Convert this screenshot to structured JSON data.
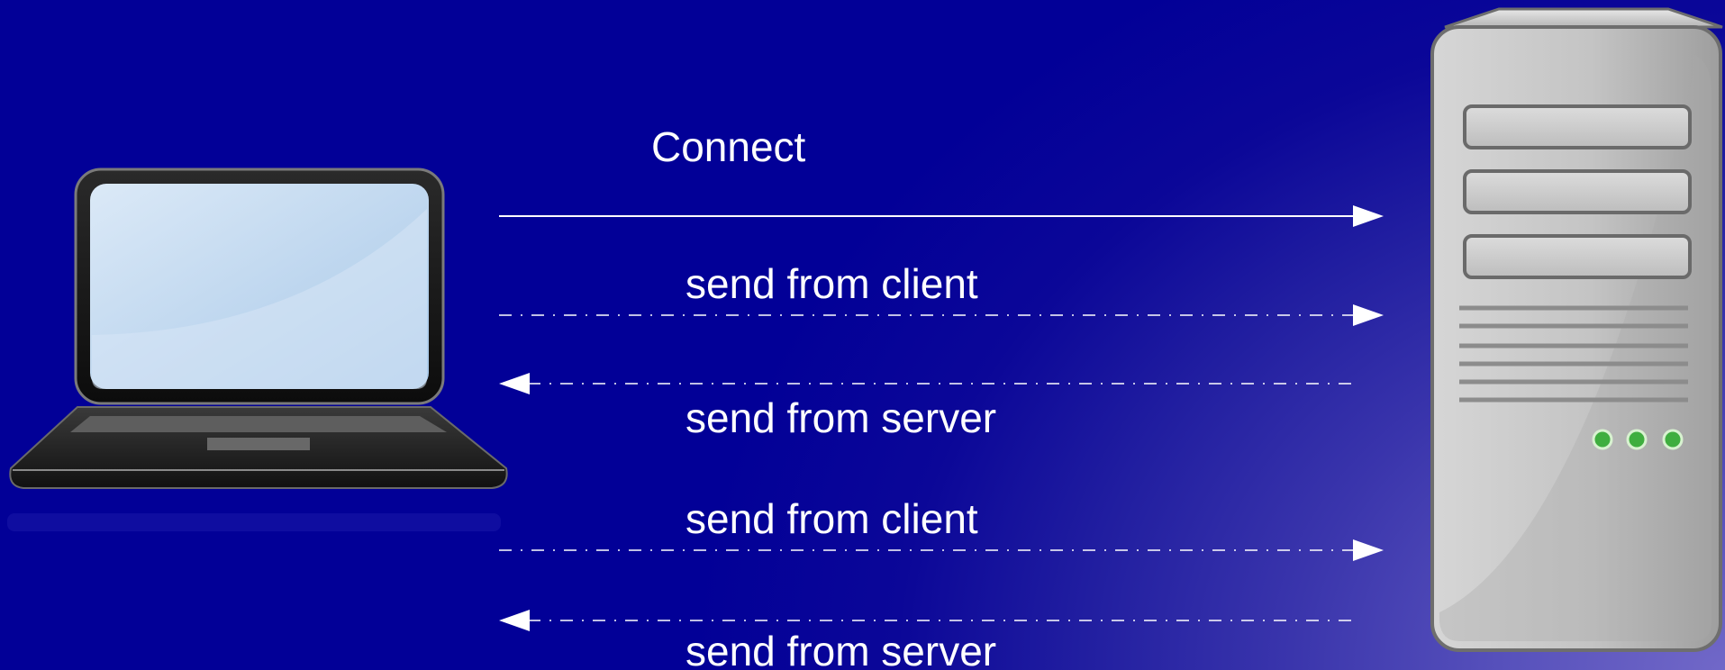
{
  "diagram": {
    "connect_label": "Connect",
    "messages": [
      {
        "label": "send from client",
        "direction": "client-to-server"
      },
      {
        "label": "send from server",
        "direction": "server-to-client"
      },
      {
        "label": "send from client",
        "direction": "client-to-server"
      },
      {
        "label": "send from server",
        "direction": "server-to-client"
      }
    ]
  },
  "colors": {
    "background_dark": "#020097",
    "background_light": "#7168c8",
    "arrow": "#ffffff",
    "server_led": "#3fae3f"
  },
  "icons": {
    "client": "laptop-icon",
    "server": "server-tower-icon"
  }
}
